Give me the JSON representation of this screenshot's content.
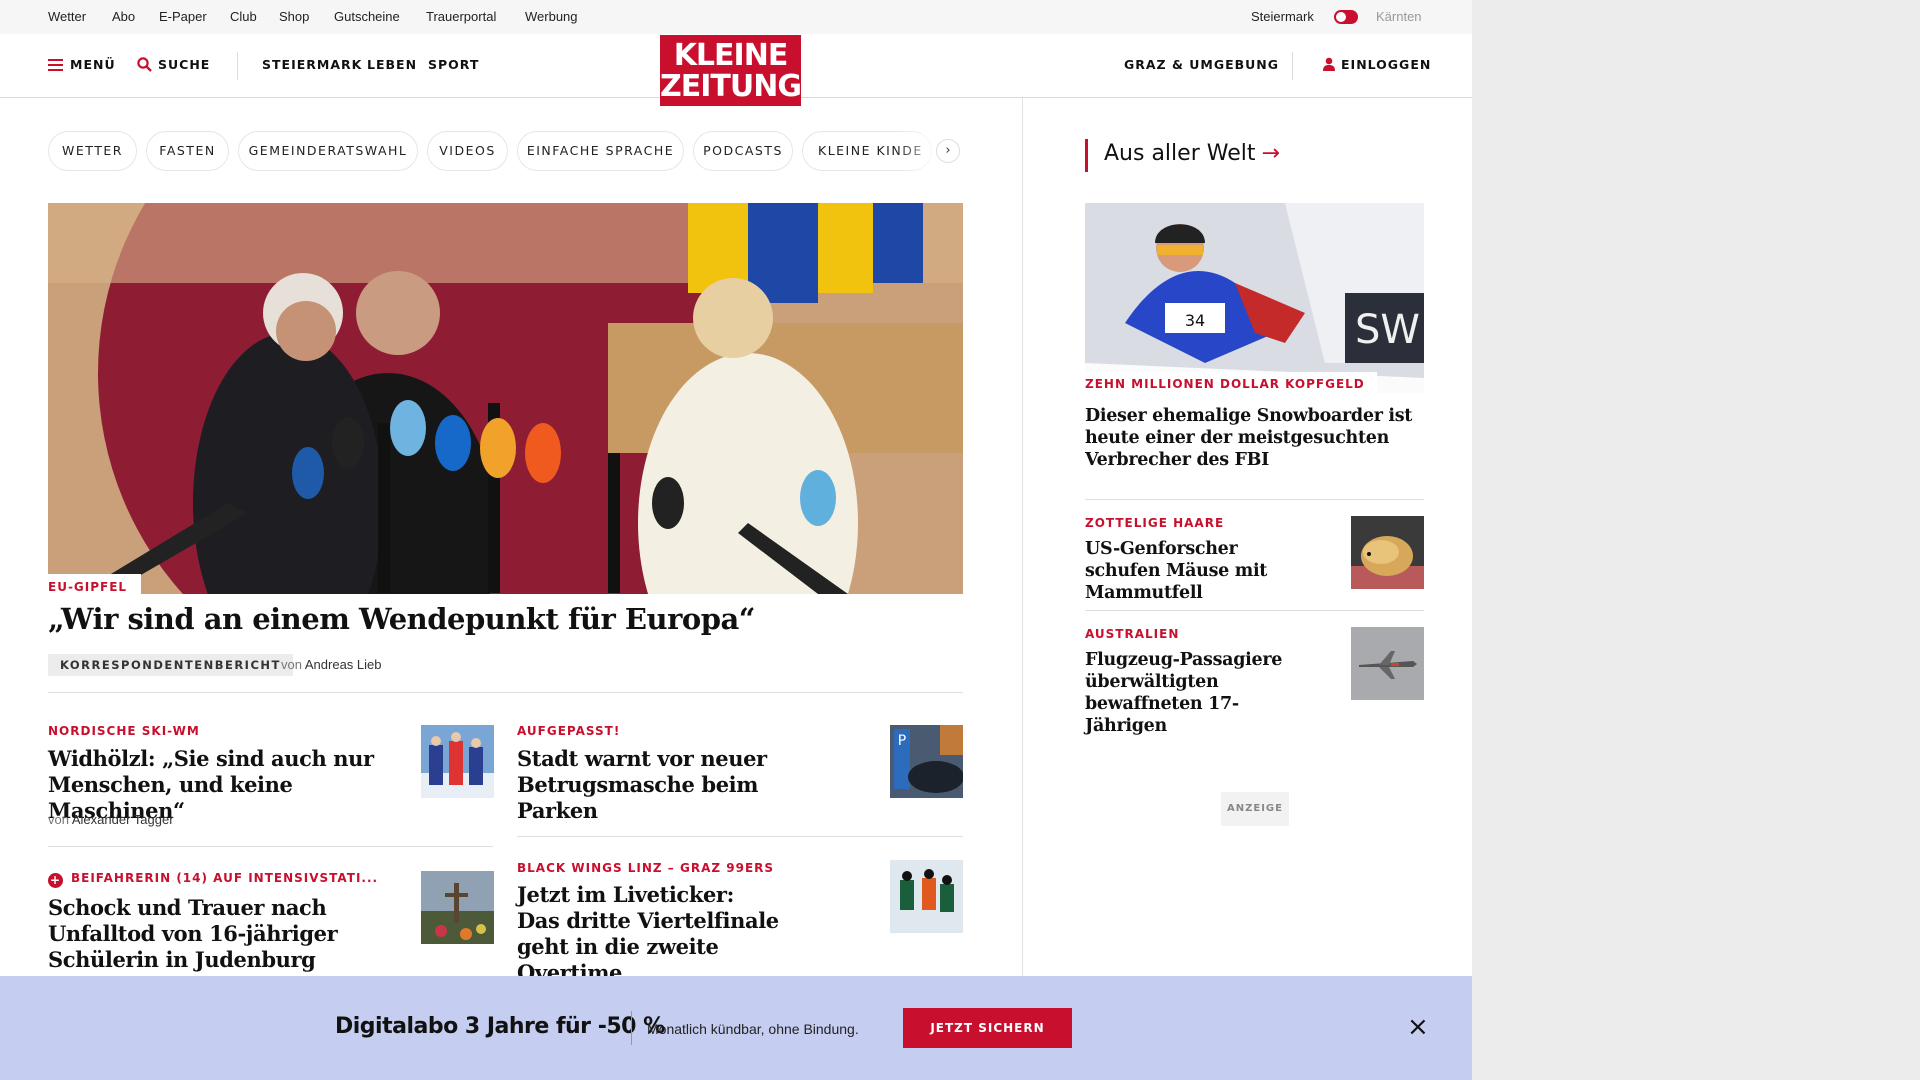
{
  "util_nav": {
    "links": [
      "Wetter",
      "Abo",
      "E-Paper",
      "Club",
      "Shop",
      "Gutscheine",
      "Trauerportal",
      "Werbung"
    ],
    "region_left": "Steiermark",
    "region_right": "Kärnten"
  },
  "header": {
    "menu": "MENÜ",
    "search": "SUCHE",
    "nav": [
      "STEIERMARK",
      "LEBEN",
      "SPORT"
    ],
    "logo_line1": "KLEINE",
    "logo_line2": "ZEITUNG",
    "region": "GRAZ & UMGEBUNG",
    "login": "EINLOGGEN"
  },
  "topics": [
    "WETTER",
    "FASTEN",
    "GEMEINDERATSWAHL",
    "VIDEOS",
    "EINFACHE SPRACHE",
    "PODCASTS",
    "KLEINE KINDE"
  ],
  "hero": {
    "kicker": "EU-GIPFEL",
    "title": "„Wir sind an einem Wendepunkt für Europa“",
    "badge": "KORRESPONDENTENBERICHT",
    "by_prefix": "von",
    "author": "Andreas Lieb"
  },
  "teasers": [
    {
      "kicker": "NORDISCHE SKI-WM",
      "title": "Widhölzl: „Sie sind auch nur Menschen, und keine Maschinen“",
      "by_prefix": "von",
      "author": "Alexander Tagger"
    },
    {
      "kicker": "AUFGEPASST!",
      "title": "Stadt warnt vor neuer Betrugsmasche beim Parken"
    },
    {
      "kicker": "BEIFAHRERIN (14) AUF INTENSIVSTATI...",
      "title": "Schock und Trauer nach Unfalltod von 16-jähriger Schülerin in Judenburg"
    },
    {
      "kicker": "BLACK WINGS LINZ – GRAZ 99ERS",
      "title": "Jetzt im Liveticker: Das dritte Viertelfinale geht in die zweite Overtime"
    }
  ],
  "sidebar": {
    "section_title": "Aus aller Welt",
    "items": [
      {
        "kicker": "ZEHN MILLIONEN DOLLAR KOPFGELD",
        "title": "Dieser ehemalige Snowboarder ist heute einer der meistgesuchten Verbrecher des FBI"
      },
      {
        "kicker": "ZOTTELIGE HAARE",
        "title": "US-Genforscher schufen Mäuse mit Mammutfell"
      },
      {
        "kicker": "AUSTRALIEN",
        "title": "Flugzeug-Passagiere überwältigten bewaffneten 17-Jährigen"
      }
    ],
    "ad_label": "ANZEIGE"
  },
  "promo": {
    "title": "Digitalabo 3 Jahre für -50 %",
    "subtitle": "Monatlich kündbar, ohne Bindung.",
    "button": "JETZT SICHERN",
    "close": "×"
  },
  "colors": {
    "brand_red": "#c8102e",
    "promo_bg": "#c5cdf0"
  }
}
